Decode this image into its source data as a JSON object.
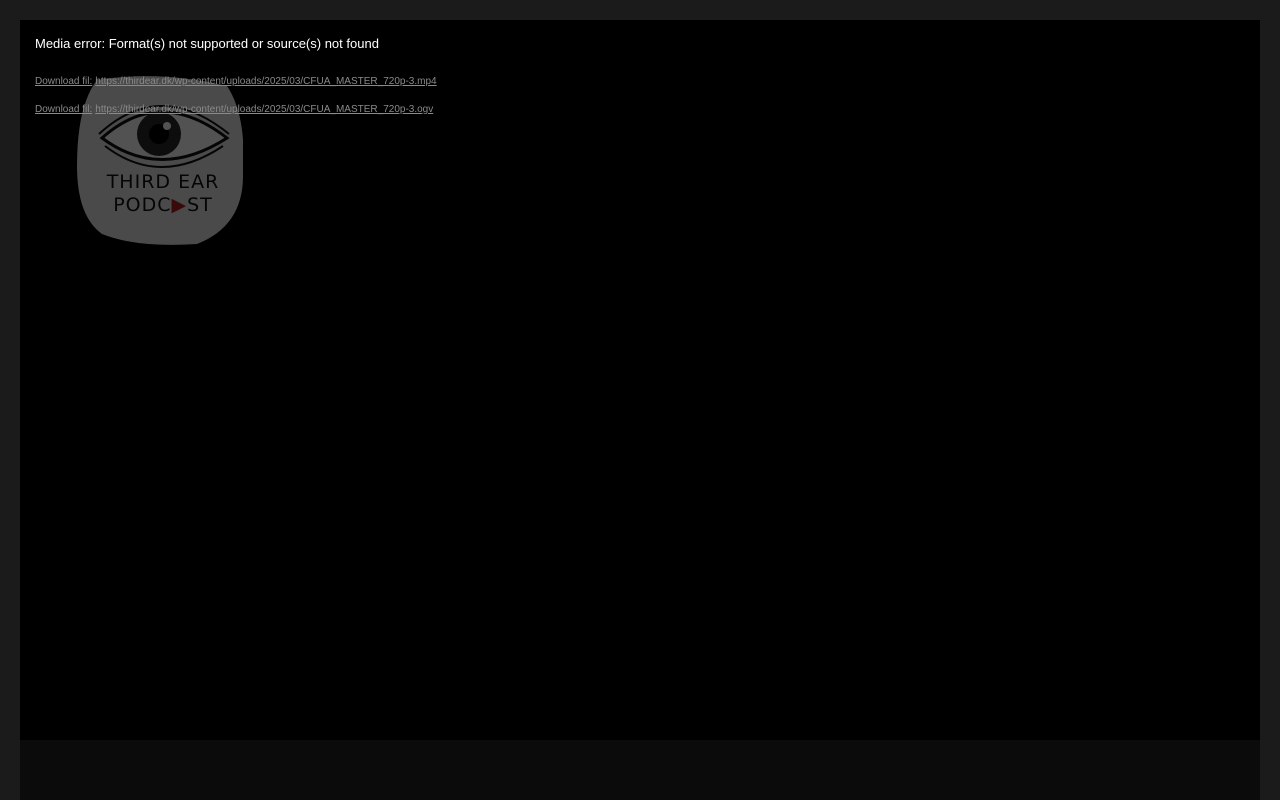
{
  "player": {
    "error_message": "Media error: Format(s) not supported or source(s) not found",
    "downloads": [
      {
        "label": "Download fil:",
        "url": "https://thirdear.dk/wp-content/uploads/2025/03/CFUA_MASTER_720p-3.mp4"
      },
      {
        "label": "Download fil:",
        "url": "https://thirdear.dk/wp-content/uploads/2025/03/CFUA_MASTER_720p-3.ogv"
      }
    ],
    "poster": {
      "icon": "eye-logo-icon",
      "line1": "THIRD EAR",
      "line2_part1": "PODC",
      "line2_part2": "ST",
      "play_glyph_color": "#b02020"
    }
  },
  "colors": {
    "page_background": "#1b1b1b",
    "player_background": "#000000",
    "error_text": "#ffffff",
    "link_text": "#8a8a8a"
  }
}
